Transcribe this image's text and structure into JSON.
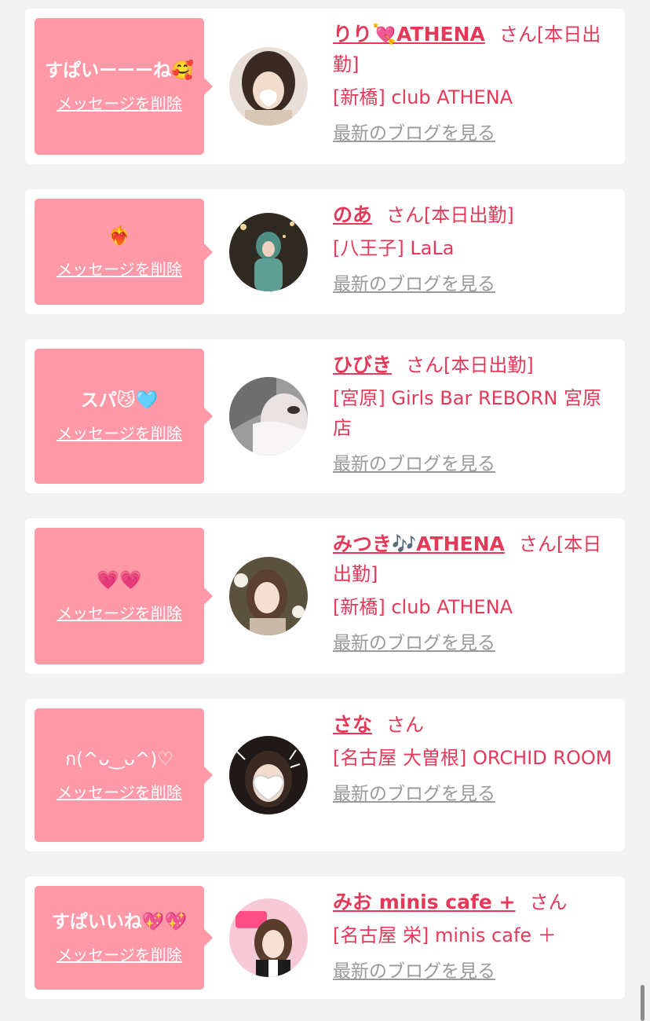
{
  "cards": [
    {
      "message": "すぱいーーーね🥰",
      "delete_label": "メッセージを削除",
      "cast_name": "りり💘ATHENA",
      "honorific": "さん",
      "status": "[本日出勤]",
      "shop": "[新橋] club ATHENA",
      "blog_link": "最新のブログを見る",
      "avatar_icon": "cast-photo-icon"
    },
    {
      "message": "❤️‍🔥",
      "delete_label": "メッセージを削除",
      "cast_name": "のあ",
      "honorific": "さん",
      "status": "[本日出勤]",
      "shop": "[八王子] LaLa",
      "blog_link": "最新のブログを見る",
      "avatar_icon": "cast-photo-icon"
    },
    {
      "message": "スパ😼🩵",
      "delete_label": "メッセージを削除",
      "cast_name": "ひびき",
      "honorific": "さん",
      "status": "[本日出勤]",
      "shop": "[宮原] Girls Bar REBORN 宮原店",
      "blog_link": "最新のブログを見る",
      "avatar_icon": "cast-photo-icon"
    },
    {
      "message": "💗💗",
      "delete_label": "メッセージを削除",
      "cast_name": "みつき🎶ATHENA",
      "honorific": "さん",
      "status": "[本日出勤]",
      "shop": "[新橋] club ATHENA",
      "blog_link": "最新のブログを見る",
      "avatar_icon": "cast-photo-icon"
    },
    {
      "message": "ก(^ᴗ‿ᴗ^)♡",
      "delete_label": "メッセージを削除",
      "cast_name": "さな",
      "honorific": "さん",
      "status": "",
      "shop": "[名古屋 大曽根] ORCHID ROOM",
      "blog_link": "最新のブログを見る",
      "avatar_icon": "cast-photo-icon"
    },
    {
      "message": "すぱいいね💖💖",
      "delete_label": "メッセージを削除",
      "cast_name": "みお minis cafe +",
      "honorific": "さん",
      "status": "",
      "shop": "[名古屋 栄] minis cafe ＋",
      "blog_link": "最新のブログを見る",
      "avatar_icon": "cast-photo-icon"
    }
  ],
  "colors": {
    "page_background": "#f2f2f2",
    "card_background": "#ffffff",
    "bubble": "#ff98a7",
    "accent_text": "#e6395a",
    "link_gray": "#9a9a9a"
  }
}
